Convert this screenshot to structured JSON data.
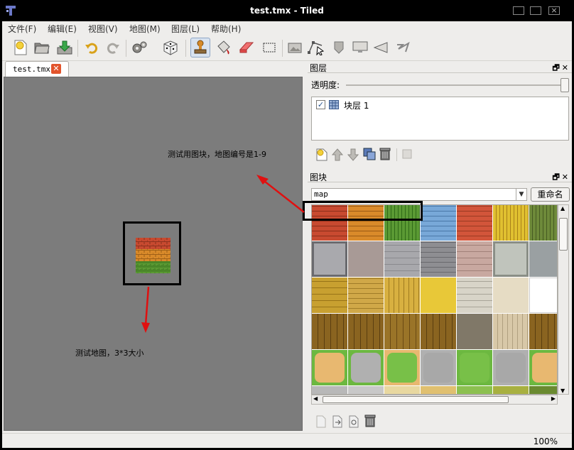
{
  "window": {
    "title": "test.tmx - Tiled"
  },
  "menu": [
    "文件(F)",
    "编辑(E)",
    "视图(V)",
    "地图(M)",
    "图层(L)",
    "帮助(H)"
  ],
  "toolbar": {
    "buttons": [
      "new-map",
      "open-file",
      "save-file",
      "undo",
      "redo",
      "random-mode",
      "dice",
      "stamp-brush",
      "bucket-fill",
      "eraser",
      "rect-select",
      "image-layer",
      "polygon",
      "object-1",
      "object-2",
      "object-3",
      "object-4"
    ]
  },
  "tab": {
    "label": "test.tmx",
    "close": "✕"
  },
  "annotations": {
    "tileset_note": "测试用图块，地图编号是1-9",
    "map_note": "测试地图，3*3大小",
    "arrow_color": "#e01010"
  },
  "layers_panel": {
    "title": "图层",
    "opacity_label": "透明度:",
    "opacity": 1.0,
    "layers": [
      {
        "name": "块层 1",
        "visible": true
      }
    ]
  },
  "tileset_panel": {
    "title": "图块",
    "tileset_name": "map",
    "rename_label": "重命名"
  },
  "status": {
    "zoom": "100%"
  },
  "colors": {
    "brick_red": "#c84a30",
    "brick_orange": "#d98a2a",
    "grass_green": "#5b9a34",
    "map_bg": "#7c7c7c"
  }
}
